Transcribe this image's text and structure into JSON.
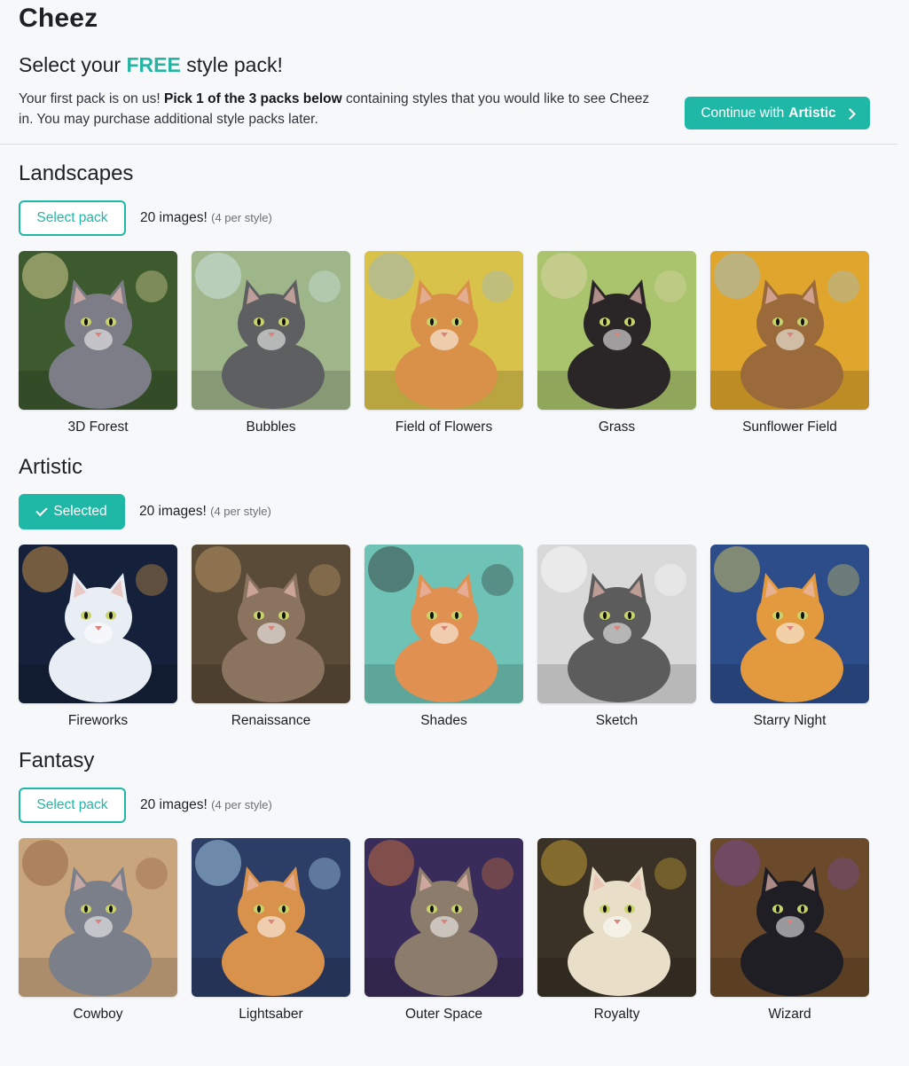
{
  "app": {
    "title": "Cheez"
  },
  "header": {
    "heading_prefix": "Select your",
    "heading_free": "FREE",
    "heading_suffix": "style pack!",
    "intro_1": "Your first pack is on us!",
    "intro_bold": "Pick 1 of the 3 packs below",
    "intro_2": "containing styles that you would like to see Cheez in. You may purchase additional style packs later.",
    "continue_prefix": "Continue with",
    "continue_pack": "Artistic"
  },
  "packs": [
    {
      "title": "Landscapes",
      "button": "Select pack",
      "selected": false,
      "count": "20 images!",
      "count_note": "(4 per style)",
      "styles": [
        {
          "name": "3D Forest",
          "bg": "#3d5a2e",
          "cat": "#7c7d86",
          "accent": "#f5e7a6"
        },
        {
          "name": "Bubbles",
          "bg": "#9fb58a",
          "cat": "#5d5f60",
          "accent": "#d8eef0"
        },
        {
          "name": "Field of Flowers",
          "bg": "#d9c24a",
          "cat": "#d9914a",
          "accent": "#8fb6d8"
        },
        {
          "name": "Grass",
          "bg": "#a9c46c",
          "cat": "#2a2628",
          "accent": "#e2d6b0"
        },
        {
          "name": "Sunflower Field",
          "bg": "#e0a52c",
          "cat": "#9a6a3a",
          "accent": "#8ec3e6"
        }
      ]
    },
    {
      "title": "Artistic",
      "button": "Selected",
      "selected": true,
      "count": "20 images!",
      "count_note": "(4 per style)",
      "styles": [
        {
          "name": "Fireworks",
          "bg": "#15213a",
          "cat": "#e9edf4",
          "accent": "#e8a54a"
        },
        {
          "name": "Renaissance",
          "bg": "#5a4a38",
          "cat": "#8a7460",
          "accent": "#c9a56c"
        },
        {
          "name": "Shades",
          "bg": "#6fc3b6",
          "cat": "#e09050",
          "accent": "#2b2b2b"
        },
        {
          "name": "Sketch",
          "bg": "#d9d9d9",
          "cat": "#5c5c5c",
          "accent": "#ffffff"
        },
        {
          "name": "Starry Night",
          "bg": "#2d4d8a",
          "cat": "#e39a3e",
          "accent": "#e8d45a"
        }
      ]
    },
    {
      "title": "Fantasy",
      "button": "Select pack",
      "selected": false,
      "count": "20 images!",
      "count_note": "(4 per style)",
      "styles": [
        {
          "name": "Cowboy",
          "bg": "#c9a57e",
          "cat": "#7a7f8a",
          "accent": "#8a5a32"
        },
        {
          "name": "Lightsaber",
          "bg": "#2c3e66",
          "cat": "#d9924c",
          "accent": "#bfe6ff"
        },
        {
          "name": "Outer Space",
          "bg": "#3a2c5a",
          "cat": "#8c7c6c",
          "accent": "#d97a3a"
        },
        {
          "name": "Royalty",
          "bg": "#3a3226",
          "cat": "#e9dfc8",
          "accent": "#e0b43a"
        },
        {
          "name": "Wizard",
          "bg": "#6a4a2a",
          "cat": "#1e1e24",
          "accent": "#7a4aa8"
        }
      ]
    }
  ]
}
